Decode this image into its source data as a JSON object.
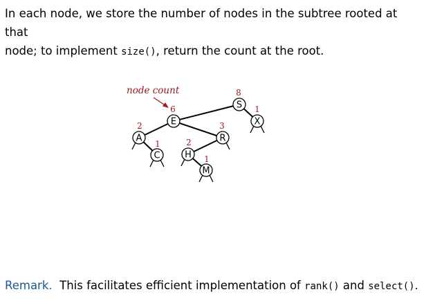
{
  "intro": {
    "line1": "In each node, we store the number of nodes in the subtree rooted at that",
    "line2_prefix": "node; to implement ",
    "line2_code": "size()",
    "line2_suffix": ", return the count at the root."
  },
  "diagram": {
    "callout_label": "node count",
    "colors": {
      "count": "#a01818",
      "remark_label": "#1a5a96"
    },
    "nodes": [
      {
        "key": "S",
        "count": "8"
      },
      {
        "key": "E",
        "count": "6"
      },
      {
        "key": "X",
        "count": "1"
      },
      {
        "key": "A",
        "count": "2"
      },
      {
        "key": "R",
        "count": "3"
      },
      {
        "key": "C",
        "count": "1"
      },
      {
        "key": "H",
        "count": "2"
      },
      {
        "key": "M",
        "count": "1"
      }
    ],
    "edges": [
      [
        "S",
        "E"
      ],
      [
        "S",
        "X"
      ],
      [
        "E",
        "A"
      ],
      [
        "E",
        "R"
      ],
      [
        "A",
        "C"
      ],
      [
        "R",
        "H"
      ],
      [
        "H",
        "M"
      ]
    ]
  },
  "remark": {
    "label": "Remark.",
    "text_prefix": "  This facilitates efficient implementation of ",
    "code1": "rank()",
    "text_mid": " and ",
    "code2": "select()",
    "text_suffix": "."
  }
}
